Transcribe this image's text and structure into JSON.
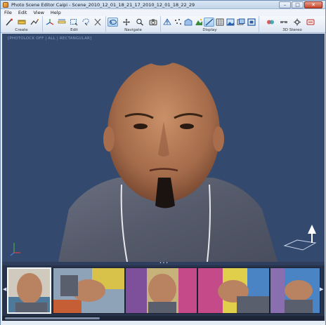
{
  "window": {
    "title": "Photo Scene Editor Caipi - Scene_2010_12_01_18_21_17_2010_12_01_18_22_29",
    "minimize_glyph": "–",
    "maximize_glyph": "□",
    "close_glyph": "✕"
  },
  "menu": [
    "File",
    "Edit",
    "View",
    "Help"
  ],
  "ribbon": {
    "groups": {
      "create": "Create",
      "edit": "Edit",
      "navigate": "Navigate",
      "display": "Display",
      "stereo": "3D Stereo"
    },
    "icons": {
      "create": [
        "pick-point-icon",
        "tape-measure-icon",
        "draw-polyline-icon"
      ],
      "edit": [
        "coordinate-axes-icon",
        "scale-ruler-icon",
        "select-region-icon",
        "lasso-select-icon",
        "delete-icon"
      ],
      "navigate": [
        "orbit-icon",
        "pan-icon",
        "zoom-icon",
        "camera-view-icon"
      ],
      "display": [
        "wireframe-icon",
        "points-icon",
        "mesh-icon",
        "textured-icon",
        "slice-icon",
        "grid-icon",
        "image-icon",
        "photo-overlay-icon",
        "frame-icon"
      ],
      "stereo": [
        "anaglyph-icon",
        "stereo-glasses-icon",
        "stereo-settings-icon",
        "stereo-mode-icon"
      ]
    }
  },
  "viewport": {
    "overlay_label": "[PHOTOLOCK OFF | ALL | RECTANGULAR]",
    "background_color": "#34496e"
  },
  "filmstrip": {
    "left_arrow": "◀",
    "right_arrow": "▶",
    "grip": "• • •",
    "thumbnails": [
      "photo-thumbnail-1",
      "photo-thumbnail-2",
      "photo-thumbnail-3",
      "photo-thumbnail-4",
      "photo-thumbnail-5"
    ],
    "selected_index": 0
  }
}
